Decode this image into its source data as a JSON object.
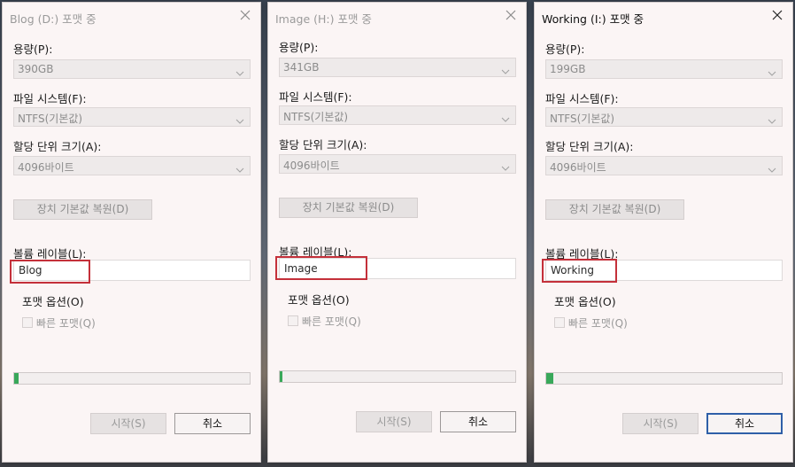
{
  "common": {
    "capacity_label": "용량(P):",
    "fs_label": "파일 시스템(F):",
    "fs_value": "NTFS(기본값)",
    "alloc_label": "할당 단위 크기(A):",
    "alloc_value": "4096바이트",
    "restore_label": "장치 기본값 복원(D)",
    "volume_label": "볼륨 레이블(L):",
    "format_options_label": "포맷 옵션(O)",
    "quick_format_label": "빠른 포맷(Q)",
    "start_label": "시작(S)",
    "cancel_label": "취소"
  },
  "dialogs": [
    {
      "title": "Blog (D:) 포맷 중",
      "capacity": "390GB",
      "volume_label": "Blog",
      "progress_fraction": 0.02,
      "active": false
    },
    {
      "title": "Image (H:) 포맷 중",
      "capacity": "341GB",
      "volume_label": "Image",
      "progress_fraction": 0.01,
      "active": false
    },
    {
      "title": "Working (I:) 포맷 중",
      "capacity": "199GB",
      "volume_label": "Working",
      "progress_fraction": 0.03,
      "active": true
    }
  ],
  "colors": {
    "highlight_box": "#c4303a",
    "progress_fill": "#39a85a",
    "focus_border": "#2f5fa8"
  }
}
